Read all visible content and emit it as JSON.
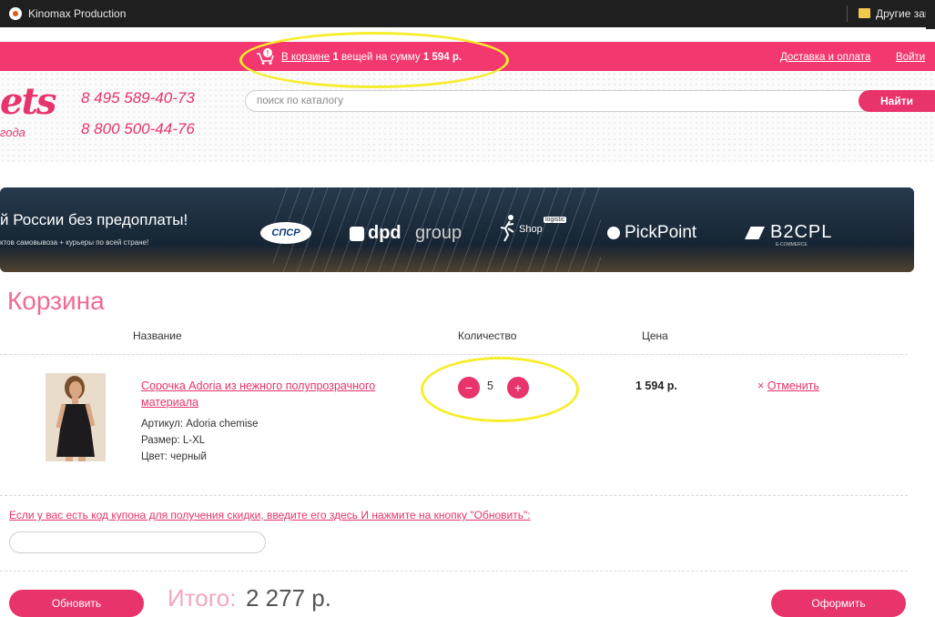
{
  "browser": {
    "bookmark_1": "Kinomax Production",
    "bookmark_2": "Другие зак"
  },
  "topbar": {
    "cart_link": "В корзине",
    "cart_count": "1",
    "cart_mid": "вещей на сумму",
    "cart_sum": "1 594 р.",
    "delivery_link": "Доставка и оплата",
    "login_link": "Войти"
  },
  "header": {
    "logo_text": "ets",
    "logo_sub": "года",
    "phone_1": "8 495 589-40-73",
    "phone_2": "8 800 500-44-76",
    "search_placeholder": "поиск по каталогу",
    "search_button": "Найти"
  },
  "banner": {
    "title": "й России без предоплаты!",
    "subtitle": "ктов самовывоза + курьеры по всей стране!",
    "spsr": "СПСР",
    "dpd": "dpd",
    "dpd_group": "group",
    "shop": "Shop",
    "shop_tag": "logistic",
    "pickpoint": "PickPoint",
    "b2cpl": "B2CPL",
    "b2cpl_sub": "E-COMMERCE"
  },
  "cart": {
    "title": "Корзина",
    "col_name": "Название",
    "col_qty": "Количество",
    "col_price": "Цена",
    "item": {
      "name": "Сорочка Adoria из нежного полупрозрачного материала",
      "article": "Артикул: Adoria chemise",
      "size": "Размер: L-XL",
      "color": "Цвет: черный",
      "qty_minus": "−",
      "qty": "5",
      "qty_plus": "+",
      "price": "1 594 р.",
      "cancel_x": "×",
      "cancel": "Отменить"
    },
    "coupon_text": "Если у вас есть код купона для получения скидки, введите его здесь И нажмите на кнопку \"Обновить\":",
    "update_button": "Обновить",
    "total_label": "Итого:",
    "total_value": "2 277 р.",
    "checkout_button": "Оформить"
  },
  "colors": {
    "accent": "#e8336b",
    "highlight": "#f6ee2d"
  }
}
